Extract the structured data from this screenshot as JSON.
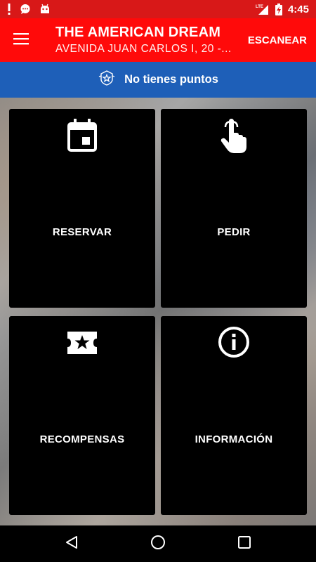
{
  "status_bar": {
    "time": "4:45",
    "network_label": "LTE",
    "icons": [
      "alert-icon",
      "chat-bubble-icon",
      "android-icon",
      "signal-icon",
      "battery-charging-icon"
    ]
  },
  "app_bar": {
    "title": "THE AMERICAN DREAM",
    "subtitle": "AVENIDA JUAN CARLOS I, 20 -...",
    "scan_label": "ESCANEAR",
    "menu_icon": "hamburger-menu-icon"
  },
  "points": {
    "text": "No tienes puntos",
    "icon": "badge-star-icon"
  },
  "tiles": [
    {
      "label": "RESERVAR",
      "icon": "calendar-icon"
    },
    {
      "label": "PEDIR",
      "icon": "hand-pointer-icon"
    },
    {
      "label": "RECOMPENSAS",
      "icon": "ticket-star-icon"
    },
    {
      "label": "INFORMACIÓN",
      "icon": "info-icon"
    }
  ],
  "nav_bar": {
    "icons": [
      "back-icon",
      "home-icon",
      "recents-icon"
    ]
  },
  "colors": {
    "status_bar": "#d81818",
    "app_bar": "#ff0a0a",
    "points_bar": "#1e5fb8",
    "tile": "#000000"
  }
}
